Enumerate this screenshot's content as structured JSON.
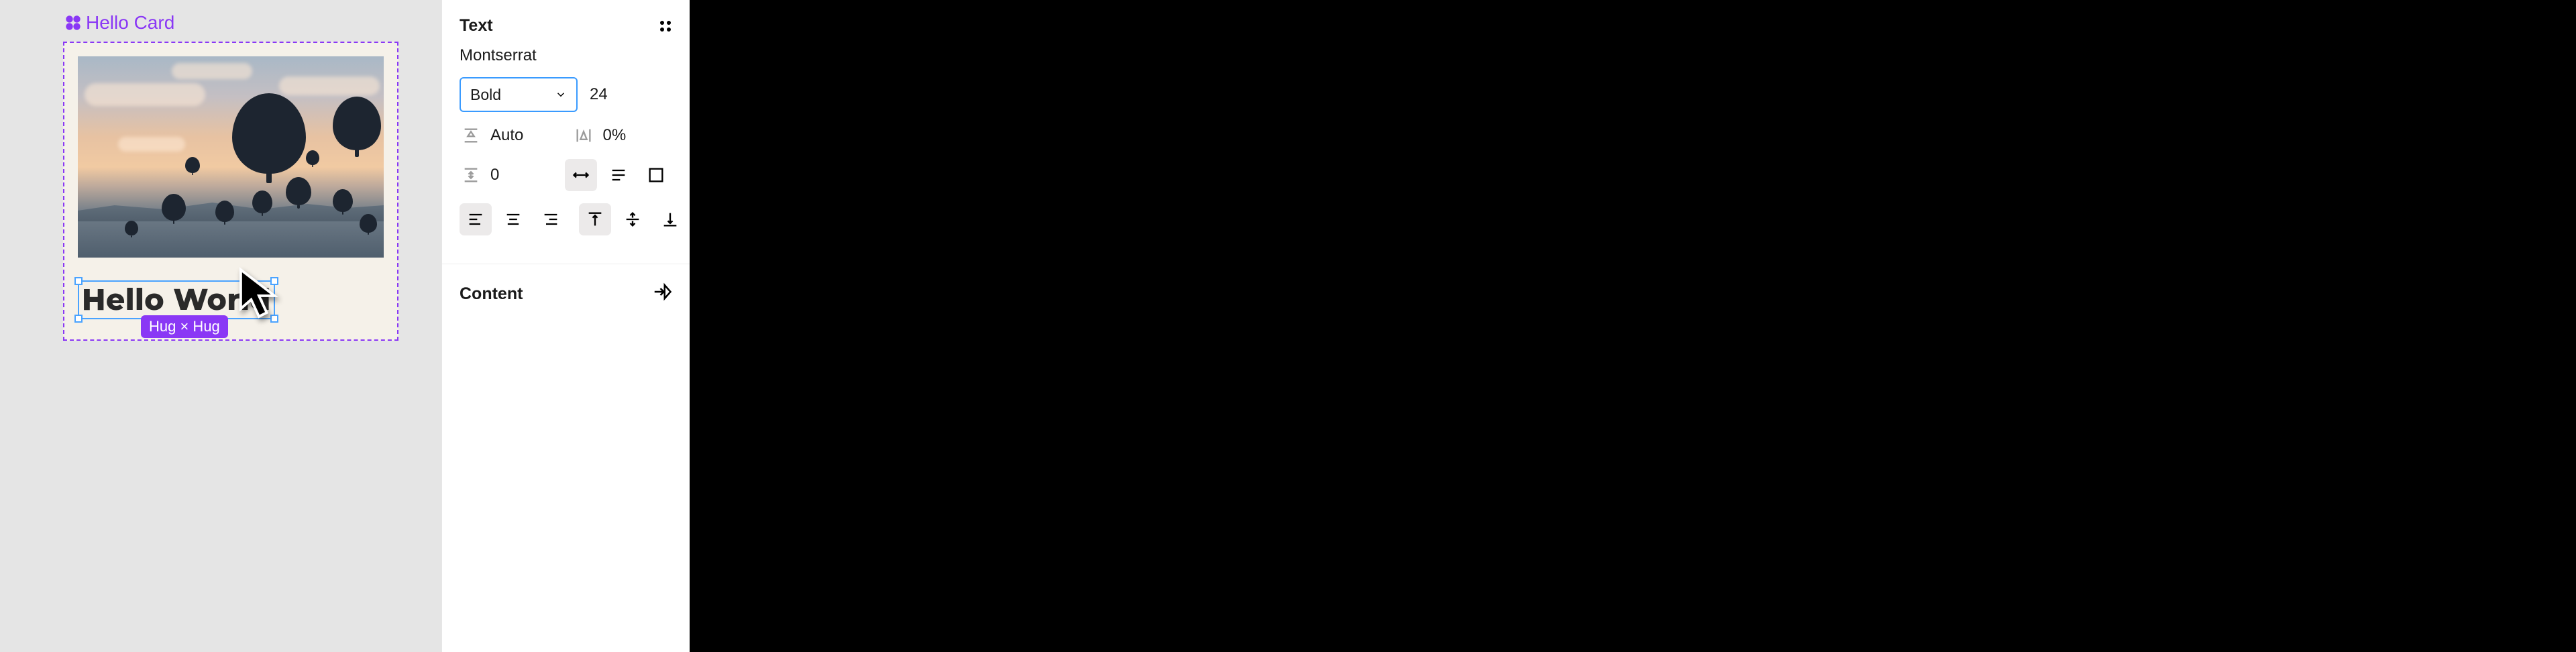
{
  "canvas": {
    "component_label": "Hello Card",
    "text_node": "Hello World",
    "size_tag": "Hug × Hug"
  },
  "panel": {
    "section_title": "Text",
    "font_family": "Montserrat",
    "font_weight_selected": "Bold",
    "font_size": "24",
    "line_height_mode": "Auto",
    "letter_spacing": "0%",
    "paragraph_spacing": "0",
    "content_title": "Content"
  }
}
